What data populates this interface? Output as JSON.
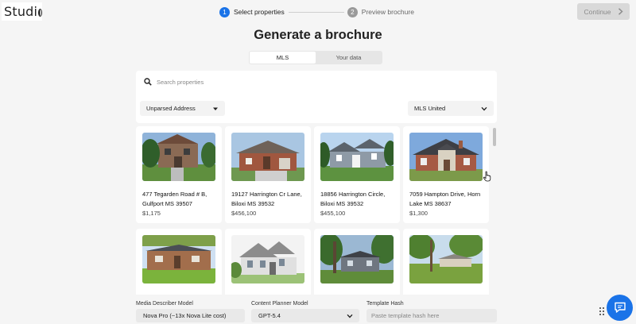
{
  "header": {
    "logo_text": "Studi",
    "steps": [
      {
        "number": "1",
        "label": "Select properties",
        "state": "active"
      },
      {
        "number": "2",
        "label": "Preview brochure",
        "state": "inactive"
      }
    ],
    "continue_label": "Continue",
    "continue_icon": "chevron-right-icon"
  },
  "main": {
    "title": "Generate a brochure",
    "tabs": [
      {
        "label": "MLS",
        "selected": true
      },
      {
        "label": "Your data",
        "selected": false
      }
    ],
    "search": {
      "placeholder": "Search properties",
      "value": "",
      "icon": "search-icon"
    },
    "filters": {
      "address_type": {
        "selected": "Unparsed Address",
        "icon": "caret-down-icon"
      },
      "mls": {
        "selected": "MLS United",
        "icon": "chevron-down-icon"
      }
    },
    "properties": [
      {
        "address": "477 Tegarden Road # B, Gulfport MS 39507",
        "price": "$1,175"
      },
      {
        "address": "19127 Harrington Cr Lane, Biloxi MS 39532",
        "price": "$456,100"
      },
      {
        "address": "18856 Harrington Circle, Biloxi MS 39532",
        "price": "$455,100"
      },
      {
        "address": "7059 Hampton Drive, Horn Lake MS 38637",
        "price": "$1,300"
      },
      {
        "address": "",
        "price": ""
      },
      {
        "address": "",
        "price": ""
      },
      {
        "address": "",
        "price": ""
      },
      {
        "address": "",
        "price": ""
      }
    ]
  },
  "footer": {
    "media_model": {
      "label": "Media Describer Model",
      "selected": "Nova Pro (~13x Nova Lite cost)"
    },
    "planner_model": {
      "label": "Content Planner Model",
      "selected": "GPT-5.4"
    },
    "template_hash": {
      "label": "Template Hash",
      "placeholder": "Paste template hash here",
      "value": ""
    }
  },
  "colors": {
    "accent": "#1a73e8",
    "background": "#f5f5f5",
    "card": "#ffffff",
    "disabled_button": "#d9d9d9"
  }
}
